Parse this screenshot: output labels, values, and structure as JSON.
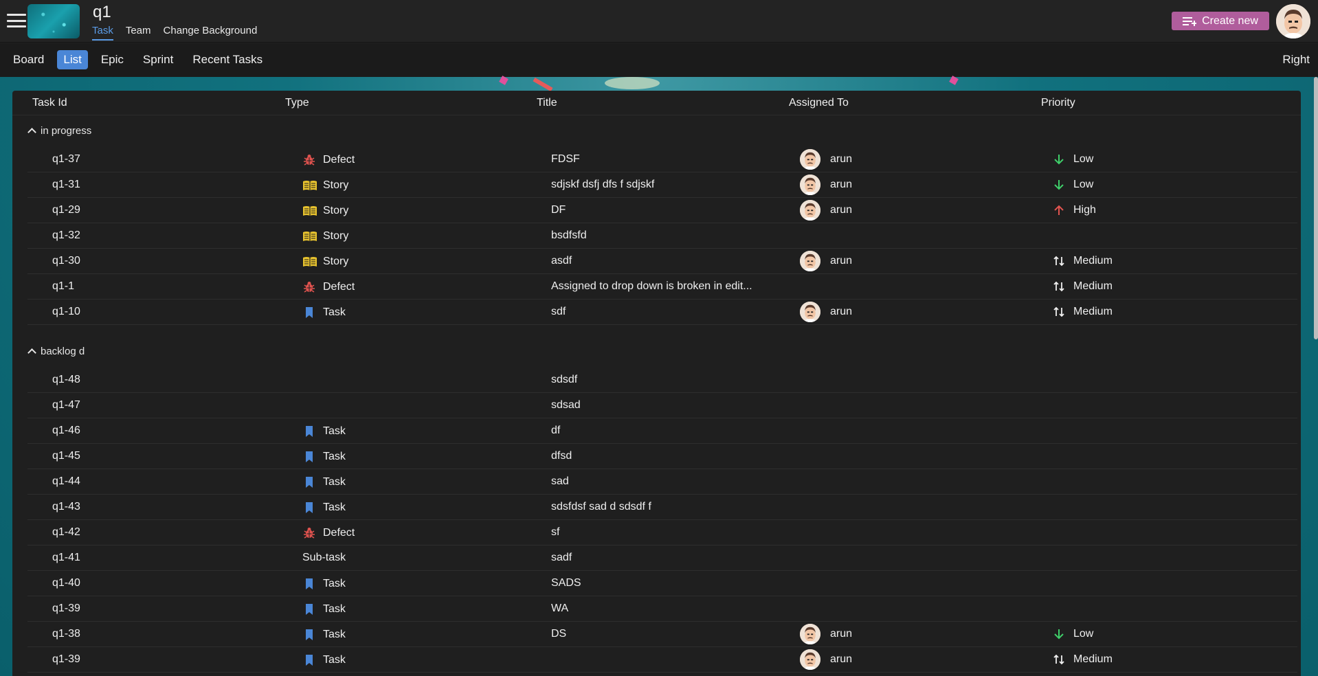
{
  "header": {
    "project_title": "q1",
    "tabs": [
      "Task",
      "Team",
      "Change Background"
    ],
    "active_tab": "Task",
    "create_label": "Create new"
  },
  "subnav": {
    "items": [
      "Board",
      "List",
      "Epic",
      "Sprint",
      "Recent Tasks"
    ],
    "active": "List",
    "right_label": "Right"
  },
  "table": {
    "columns": [
      "Task Id",
      "Type",
      "Title",
      "Assigned To",
      "Priority"
    ]
  },
  "groups": [
    {
      "name": "in progress",
      "rows": [
        {
          "id": "q1-37",
          "type": "Defect",
          "title": "FDSF",
          "assignee": "arun",
          "priority": "Low"
        },
        {
          "id": "q1-31",
          "type": "Story",
          "title": "sdjskf dsfj dfs f sdjskf",
          "assignee": "arun",
          "priority": "Low"
        },
        {
          "id": "q1-29",
          "type": "Story",
          "title": "DF",
          "assignee": "arun",
          "priority": "High"
        },
        {
          "id": "q1-32",
          "type": "Story",
          "title": "bsdfsfd",
          "assignee": "",
          "priority": ""
        },
        {
          "id": "q1-30",
          "type": "Story",
          "title": "asdf",
          "assignee": "arun",
          "priority": "Medium"
        },
        {
          "id": "q1-1",
          "type": "Defect",
          "title": "Assigned to drop down is broken in edit...",
          "assignee": "",
          "priority": "Medium"
        },
        {
          "id": "q1-10",
          "type": "Task",
          "title": "sdf",
          "assignee": "arun",
          "priority": "Medium"
        }
      ]
    },
    {
      "name": "backlog d",
      "rows": [
        {
          "id": "q1-48",
          "type": "",
          "title": "sdsdf",
          "assignee": "",
          "priority": ""
        },
        {
          "id": "q1-47",
          "type": "",
          "title": "sdsad",
          "assignee": "",
          "priority": ""
        },
        {
          "id": "q1-46",
          "type": "Task",
          "title": "df",
          "assignee": "",
          "priority": ""
        },
        {
          "id": "q1-45",
          "type": "Task",
          "title": "dfsd",
          "assignee": "",
          "priority": ""
        },
        {
          "id": "q1-44",
          "type": "Task",
          "title": "sad",
          "assignee": "",
          "priority": ""
        },
        {
          "id": "q1-43",
          "type": "Task",
          "title": "sdsfdsf sad d sdsdf f",
          "assignee": "",
          "priority": ""
        },
        {
          "id": "q1-42",
          "type": "Defect",
          "title": "sf",
          "assignee": "",
          "priority": ""
        },
        {
          "id": "q1-41",
          "type": "Sub-task",
          "title": "sadf",
          "assignee": "",
          "priority": ""
        },
        {
          "id": "q1-40",
          "type": "Task",
          "title": "SADS",
          "assignee": "",
          "priority": ""
        },
        {
          "id": "q1-39",
          "type": "Task",
          "title": "WA",
          "assignee": "",
          "priority": ""
        },
        {
          "id": "q1-38",
          "type": "Task",
          "title": "DS",
          "assignee": "arun",
          "priority": "Low"
        },
        {
          "id": "q1-39",
          "type": "Task",
          "title": "",
          "assignee": "arun",
          "priority": "Medium"
        }
      ]
    }
  ],
  "type_icons": {
    "Defect": "bug-icon",
    "Story": "book-icon",
    "Task": "bookmark-icon",
    "Sub-task": ""
  },
  "priority_icons": {
    "Low": "arrow-down-icon",
    "High": "arrow-up-icon",
    "Medium": "arrow-up-down-icon"
  },
  "colors": {
    "accent": "#5b9be6",
    "active_pill": "#4a86d6",
    "create_button": "#b05d9c",
    "defect": "#e0534f",
    "story": "#e8c32e",
    "task": "#4a86d6",
    "low": "#3fcf6a",
    "high": "#e0534f"
  }
}
